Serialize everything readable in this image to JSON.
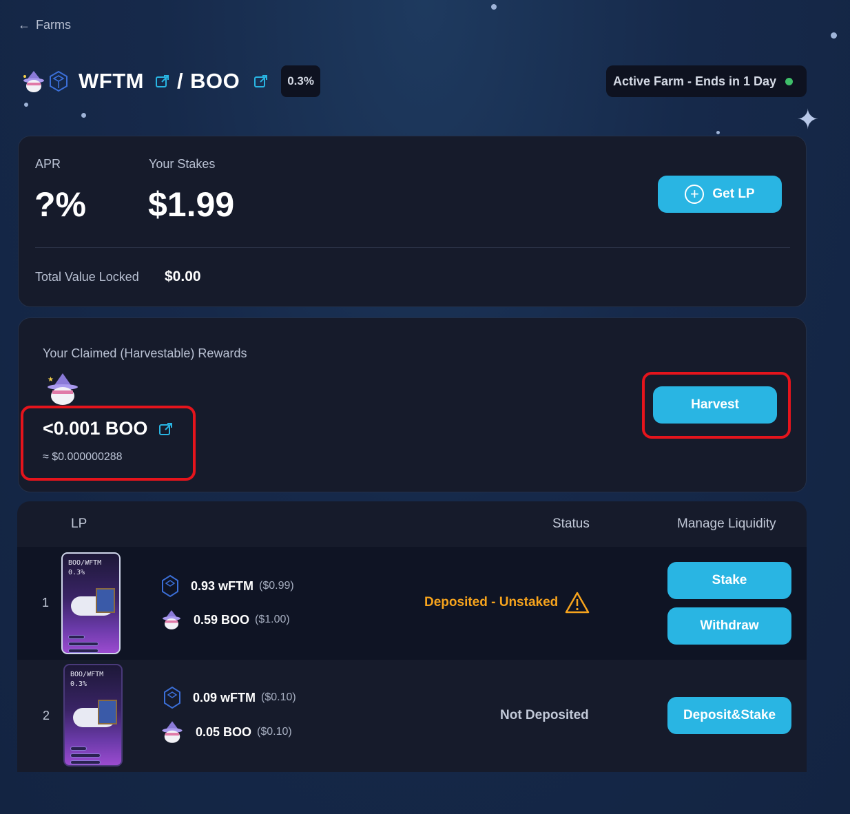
{
  "nav": {
    "back_label": "Farms"
  },
  "header": {
    "token_a": "WFTM",
    "separator": "/",
    "token_b": "BOO",
    "fee": "0.3%",
    "farm_status": "Active Farm - Ends in 1 Day",
    "status_color": "#3fbf6a"
  },
  "summary": {
    "apr_label": "APR",
    "apr_value": "?%",
    "stakes_label": "Your Stakes",
    "stakes_value": "$1.99",
    "get_lp_label": "Get LP",
    "tvl_label": "Total Value Locked",
    "tvl_value": "$0.00"
  },
  "rewards": {
    "label": "Your Claimed (Harvestable) Rewards",
    "amount": "<0.001 BOO",
    "usd": "≈ $0.000000288",
    "harvest_label": "Harvest"
  },
  "table": {
    "columns": [
      "LP",
      "Status",
      "Manage Liquidity"
    ],
    "rows": [
      {
        "index": "1",
        "nft_title": "BOO/WFTM",
        "nft_fee": "0.3%",
        "token_a_amount": "0.93 wFTM",
        "token_a_usd": "($0.99)",
        "token_b_amount": "0.59 BOO",
        "token_b_usd": "($1.00)",
        "status": "Deposited - Unstaked",
        "actions": [
          "Stake",
          "Withdraw"
        ]
      },
      {
        "index": "2",
        "nft_title": "BOO/WFTM",
        "nft_fee": "0.3%",
        "token_a_amount": "0.09 wFTM",
        "token_a_usd": "($0.10)",
        "token_b_amount": "0.05 BOO",
        "token_b_usd": "($0.10)",
        "status": "Not Deposited",
        "actions": [
          "Deposit&Stake"
        ]
      }
    ]
  },
  "colors": {
    "accent": "#29b5e3",
    "warning": "#f7a41d",
    "highlight": "#e5141c",
    "card_bg": "#161b2b"
  }
}
